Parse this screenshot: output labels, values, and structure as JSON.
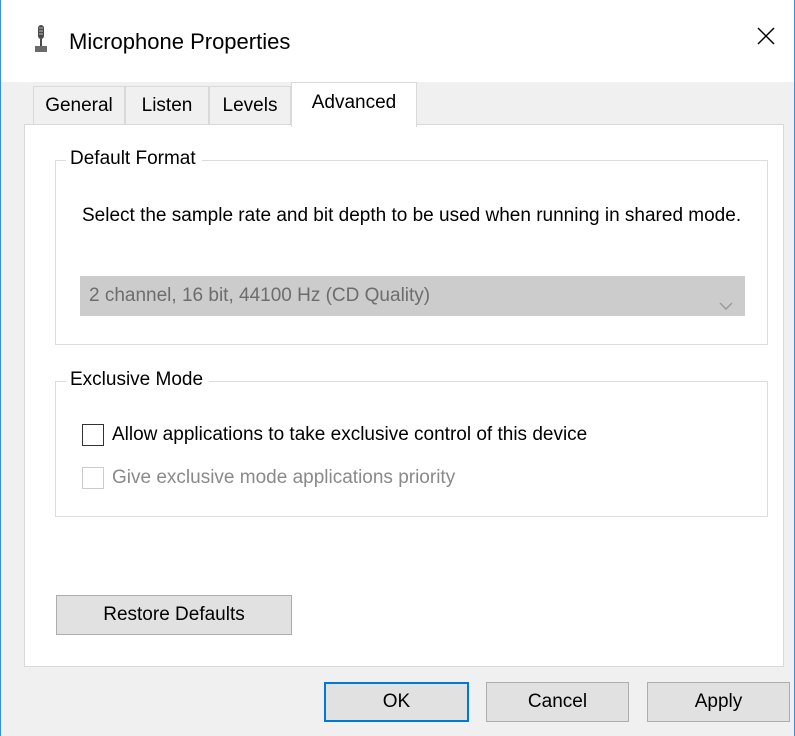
{
  "window": {
    "title": "Microphone Properties",
    "close_icon": "close-icon",
    "app_icon": "microphone-icon",
    "accent": "#0078d7",
    "frame_color": "#3a8fd8"
  },
  "tabs": [
    {
      "label": "General",
      "active": false
    },
    {
      "label": "Listen",
      "active": false
    },
    {
      "label": "Levels",
      "active": false
    },
    {
      "label": "Advanced",
      "active": true
    }
  ],
  "default_format": {
    "group_label": "Default Format",
    "description": "Select the sample rate and bit depth to be used when running in shared mode.",
    "selected_value": "2 channel, 16 bit, 44100 Hz (CD Quality)",
    "enabled": false
  },
  "exclusive_mode": {
    "group_label": "Exclusive Mode",
    "allow_label": "Allow applications to take exclusive control of this device",
    "allow_checked": false,
    "priority_label": "Give exclusive mode applications priority",
    "priority_checked": false,
    "priority_enabled": false
  },
  "buttons": {
    "restore_defaults": "Restore Defaults",
    "ok": "OK",
    "cancel": "Cancel",
    "apply": "Apply"
  }
}
